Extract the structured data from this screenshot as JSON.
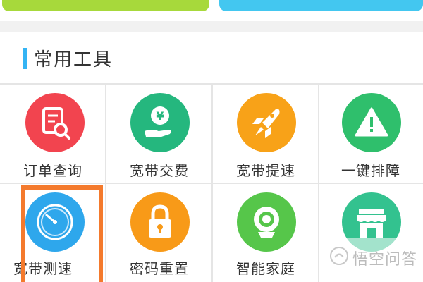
{
  "section": {
    "title": "常用工具"
  },
  "tools": [
    {
      "label": "订单查询",
      "icon": "order-search-icon",
      "color": "#f2444f"
    },
    {
      "label": "宽带交费",
      "icon": "yuan-hand-icon",
      "color": "#25b77e"
    },
    {
      "label": "宽带提速",
      "icon": "rocket-icon",
      "color": "#f8a218"
    },
    {
      "label": "一键排障",
      "icon": "warning-icon",
      "color": "#2fbf6c"
    },
    {
      "label": "宽带测速",
      "icon": "speedometer-icon",
      "color": "#2ea7ec"
    },
    {
      "label": "密码重置",
      "icon": "lock-icon",
      "color": "#f89a18"
    },
    {
      "label": "智能家庭",
      "icon": "camera-icon",
      "color": "#56c64a"
    },
    {
      "label": "",
      "icon": "store-icon",
      "color": "#33c28f"
    }
  ],
  "colors": {
    "top_left_button": "#a7d93b",
    "top_right_button": "#43c7f0",
    "accent": "#34b4f4",
    "highlight_box": "#f47a2d"
  },
  "watermark": {
    "text": "悟空问答",
    "icon": "logo-icon"
  }
}
